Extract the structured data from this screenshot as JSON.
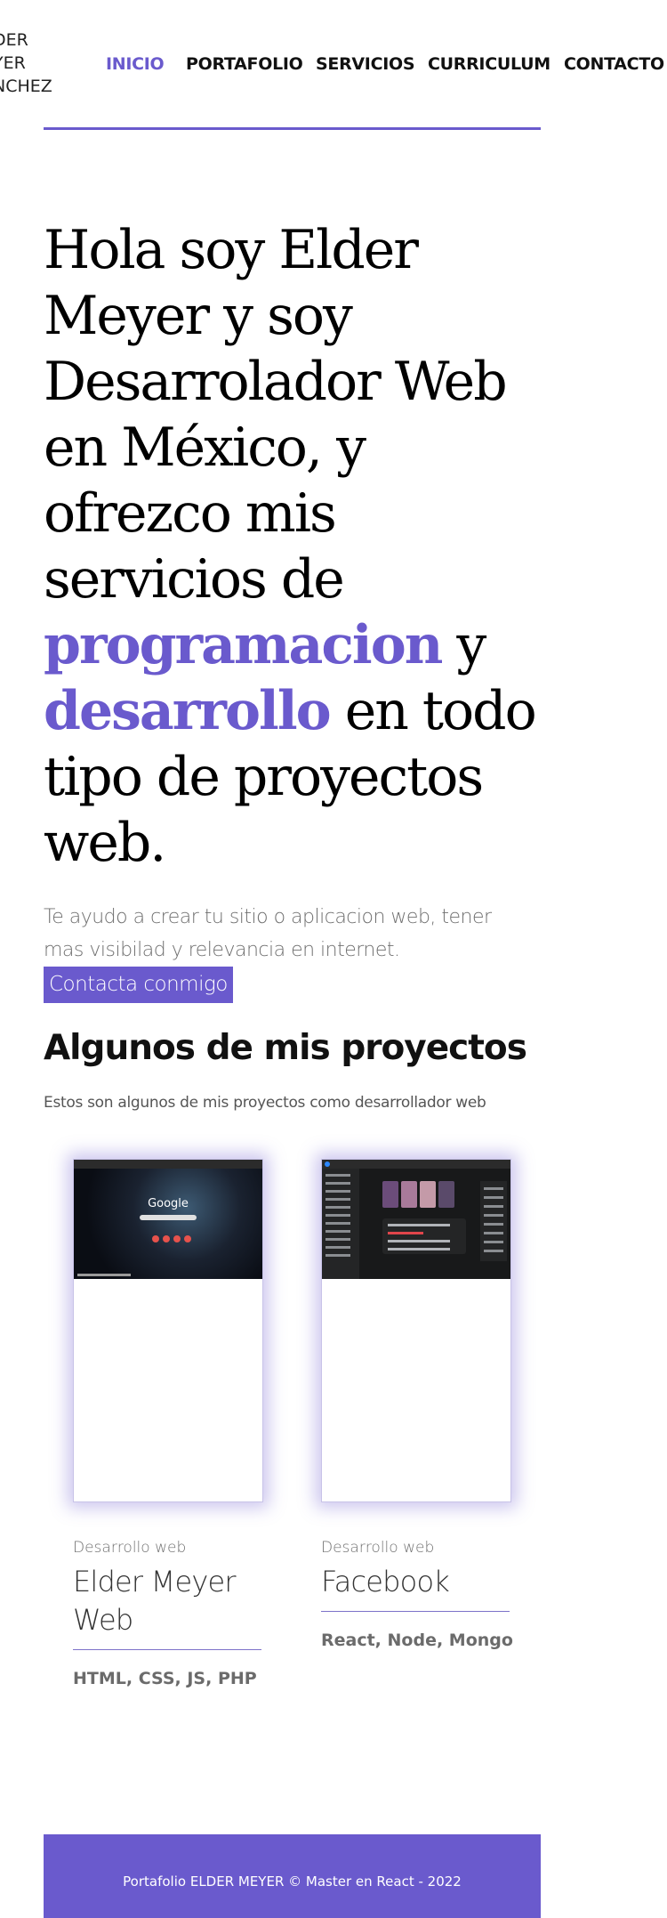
{
  "header": {
    "logo_text": "DER\nYER\nNCHEZ",
    "nav": [
      {
        "label": "INICIO",
        "active": true
      },
      {
        "label": "PORTAFOLIO",
        "active": false
      },
      {
        "label": "SERVICIOS",
        "active": false
      },
      {
        "label": "CURRICULUM",
        "active": false
      },
      {
        "label": "CONTACTO",
        "active": false
      }
    ]
  },
  "hero": {
    "text_before": "Hola soy Elder Meyer y soy Desarrolador Web en México, y ofrezco mis servicios de ",
    "accent_1": "programacion",
    "text_mid": " y ",
    "accent_2": "desarrollo",
    "text_after": " en todo tipo de proyectos web.",
    "subtitle": "Te ayudo a crear tu sitio o aplicacion web, tener mas visibilad y relevancia en internet.",
    "contact_button": "Contacta conmigo"
  },
  "projects": {
    "title": "Algunos de mis proyectos",
    "description": "Estos son algunos de mis proyectos como desarrollador web",
    "items": [
      {
        "category": "Desarrollo web",
        "title": "Elder Meyer Web",
        "tech": "HTML, CSS, JS, PHP",
        "screenshot_logo": "Google"
      },
      {
        "category": "Desarrollo web",
        "title": "Facebook",
        "tech": "React, Node, Mongo"
      }
    ]
  },
  "footer": {
    "text": "Portafolio ELDER MEYER © Master en React - 2022"
  },
  "colors": {
    "accent": "#6a5acd",
    "text": "#000000",
    "muted": "#6f6f6f"
  }
}
